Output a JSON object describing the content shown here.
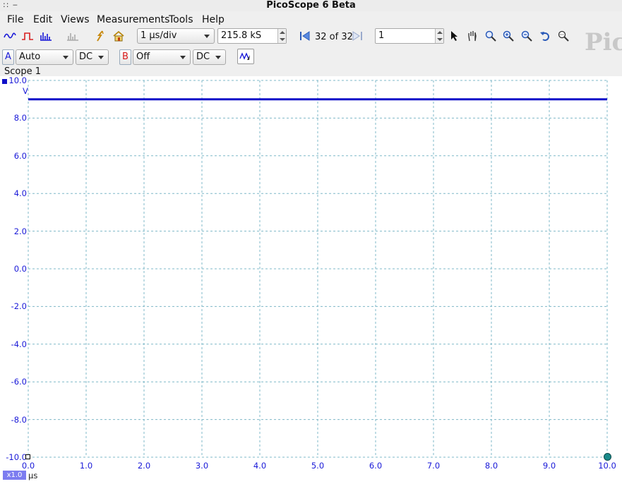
{
  "window": {
    "title": "PicoScope 6 Beta",
    "control_glyphs": ":: ‒"
  },
  "menu": [
    "File",
    "Edit",
    "Views",
    "Measurements",
    "Tools",
    "Help"
  ],
  "toolbar": {
    "timebase": "1 µs/div",
    "samples": "215.8 kS",
    "buffer_label": "32 of 32",
    "capture_count": "1"
  },
  "channels": {
    "a": {
      "letter": "A",
      "range": "Auto",
      "coupling": "DC",
      "color": "#1a1ad8"
    },
    "b": {
      "letter": "B",
      "range": "Off",
      "coupling": "DC",
      "color": "#d81a1a"
    }
  },
  "tab": {
    "label": "Scope 1"
  },
  "logo": {
    "text": "Pic"
  },
  "axes": {
    "y_unit": "V",
    "x_unit": "µs",
    "zoom": "x1.0",
    "y_ticks": [
      "10.0",
      "8.0",
      "6.0",
      "4.0",
      "2.0",
      "0.0",
      "-2.0",
      "-4.0",
      "-6.0",
      "-8.0",
      "-10.0"
    ],
    "x_ticks": [
      "0.0",
      "1.0",
      "2.0",
      "3.0",
      "4.0",
      "5.0",
      "6.0",
      "7.0",
      "8.0",
      "9.0",
      "10.0"
    ]
  },
  "chart_data": {
    "type": "line",
    "title": "",
    "xlabel": "µs",
    "ylabel": "V",
    "xlim": [
      0,
      10
    ],
    "ylim": [
      -10,
      10
    ],
    "grid": true,
    "series": [
      {
        "x": [
          0.0,
          10.0
        ],
        "y": [
          9.0,
          9.0
        ],
        "color": "#1010c8"
      }
    ]
  }
}
